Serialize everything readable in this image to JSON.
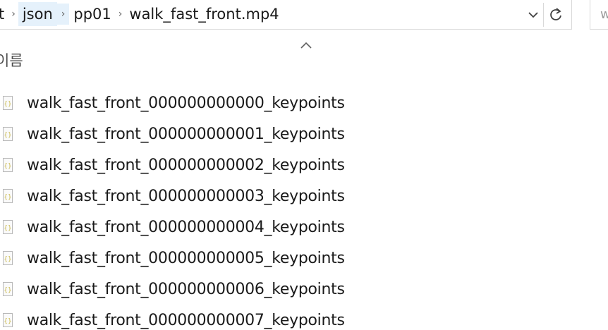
{
  "address_bar": {
    "crumbs": [
      {
        "label": "t",
        "selected": false
      },
      {
        "label": "json",
        "selected": true
      },
      {
        "label": "pp01",
        "selected": false
      },
      {
        "label": "walk_fast_front.mp4",
        "selected": false
      }
    ],
    "dropdown_icon": "chevron-down-icon",
    "refresh_icon": "refresh-icon"
  },
  "search": {
    "text": "w"
  },
  "column": {
    "name_header": "이름",
    "sort_icon": "sort-up-icon"
  },
  "files": [
    {
      "name": "walk_fast_front_000000000000_keypoints",
      "icon": "json-file-icon"
    },
    {
      "name": "walk_fast_front_000000000001_keypoints",
      "icon": "json-file-icon"
    },
    {
      "name": "walk_fast_front_000000000002_keypoints",
      "icon": "json-file-icon"
    },
    {
      "name": "walk_fast_front_000000000003_keypoints",
      "icon": "json-file-icon"
    },
    {
      "name": "walk_fast_front_000000000004_keypoints",
      "icon": "json-file-icon"
    },
    {
      "name": "walk_fast_front_000000000005_keypoints",
      "icon": "json-file-icon"
    },
    {
      "name": "walk_fast_front_000000000006_keypoints",
      "icon": "json-file-icon"
    },
    {
      "name": "walk_fast_front_000000000007_keypoints",
      "icon": "json-file-icon"
    }
  ],
  "colors": {
    "selected_crumb": "#e5f1fb",
    "border": "#d9d9d9",
    "icon_accent": "#c9d84a"
  }
}
